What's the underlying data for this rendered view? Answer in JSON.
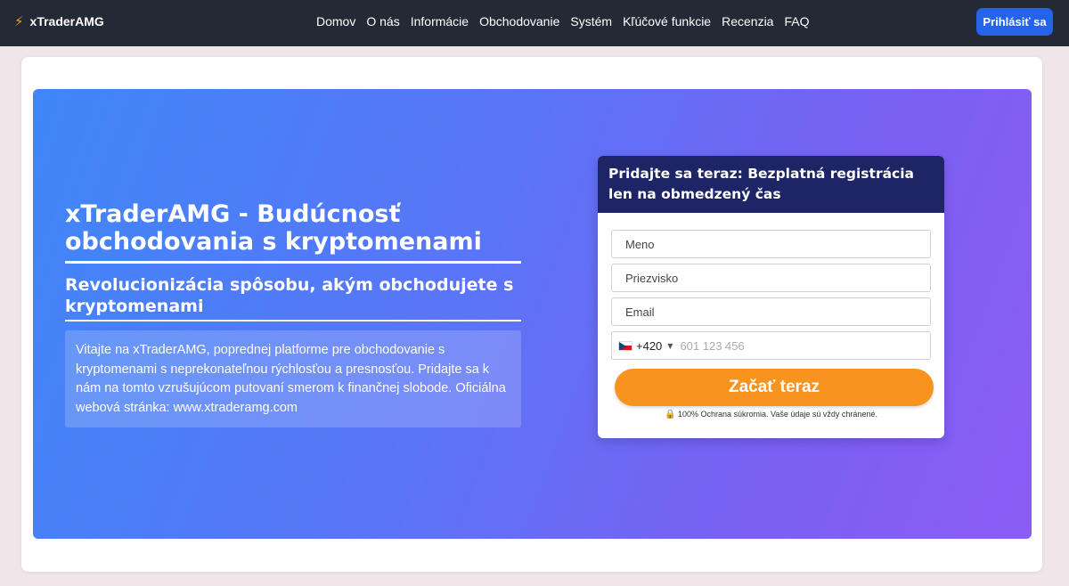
{
  "nav": {
    "brand": "xTraderAMG",
    "brand_icon": "lightning-icon",
    "items": [
      "Domov",
      "O nás",
      "Informácie",
      "Obchodovanie",
      "Systém",
      "Kľúčové funkcie",
      "Recenzia",
      "FAQ"
    ],
    "login_label": "Prihlásiť sa"
  },
  "hero": {
    "title": "xTraderAMG - Budúcnosť obchodovania s kryptomenami",
    "subtitle": "Revolucionizácia spôsobu, akým obchodujete s kryptomenami",
    "description": "Vitajte na xTraderAMG, poprednej platforme pre obchodovanie s kryptomenami s neprekonateľnou rýchlosťou a presnosťou. Pridajte sa k nám na tomto vzrušujúcom putovaní smerom k finančnej slobode. Oficiálna webová stránka: www.xtraderamg.com"
  },
  "form": {
    "header": "Pridajte sa teraz: Bezplatná registrácia len na obmedzený čas",
    "first_name_placeholder": "Meno",
    "last_name_placeholder": "Priezvisko",
    "email_placeholder": "Email",
    "country_flag": "cz-flag-icon",
    "dial_code": "+420",
    "phone_placeholder": "601 123 456",
    "submit_label": "Začať teraz",
    "privacy_text": "100% Ochrana súkromia. Vaše údaje sú vždy chránené."
  },
  "colors": {
    "nav_bg": "#232a35",
    "login_bg": "#2563eb",
    "hero_gradient_start": "#3f86f8",
    "hero_gradient_end": "#8b5cf6",
    "form_header_bg": "#1e2566",
    "cta_bg": "#f7931e"
  }
}
